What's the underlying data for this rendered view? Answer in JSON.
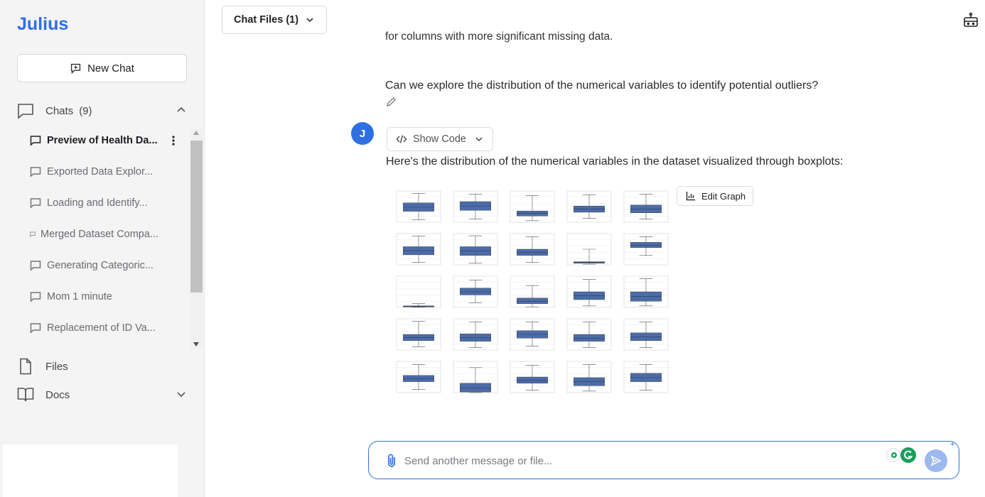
{
  "app": {
    "name": "Julius",
    "accent": "#2f6fe4"
  },
  "sidebar": {
    "new_chat_label": "New Chat",
    "chats_label": "Chats",
    "chats_count": "(9)",
    "chats": [
      {
        "label": "Preview of Health Da...",
        "active": true
      },
      {
        "label": "Exported Data Explor...",
        "active": false
      },
      {
        "label": "Loading and Identify...",
        "active": false
      },
      {
        "label": "Merged Dataset Compa...",
        "active": false
      },
      {
        "label": "Generating Categoric...",
        "active": false
      },
      {
        "label": "Mom 1 minute",
        "active": false
      },
      {
        "label": "Replacement of ID Va...",
        "active": false
      }
    ],
    "files_label": "Files",
    "docs_label": "Docs"
  },
  "header": {
    "chat_files_label": "Chat Files (1)"
  },
  "conversation": {
    "clipped_previous": "for columns with more significant missing data.",
    "user_message": "Can we explore the distribution of the numerical variables to identify potential outliers?",
    "assistant_avatar": "J",
    "show_code_label": "Show Code",
    "assistant_message": "Here's the distribution of the numerical variables in the dataset visualized through boxplots:",
    "edit_graph_label": "Edit Graph",
    "box_color": "#4c6ca8"
  },
  "composer": {
    "placeholder": "Send another message or file..."
  }
}
